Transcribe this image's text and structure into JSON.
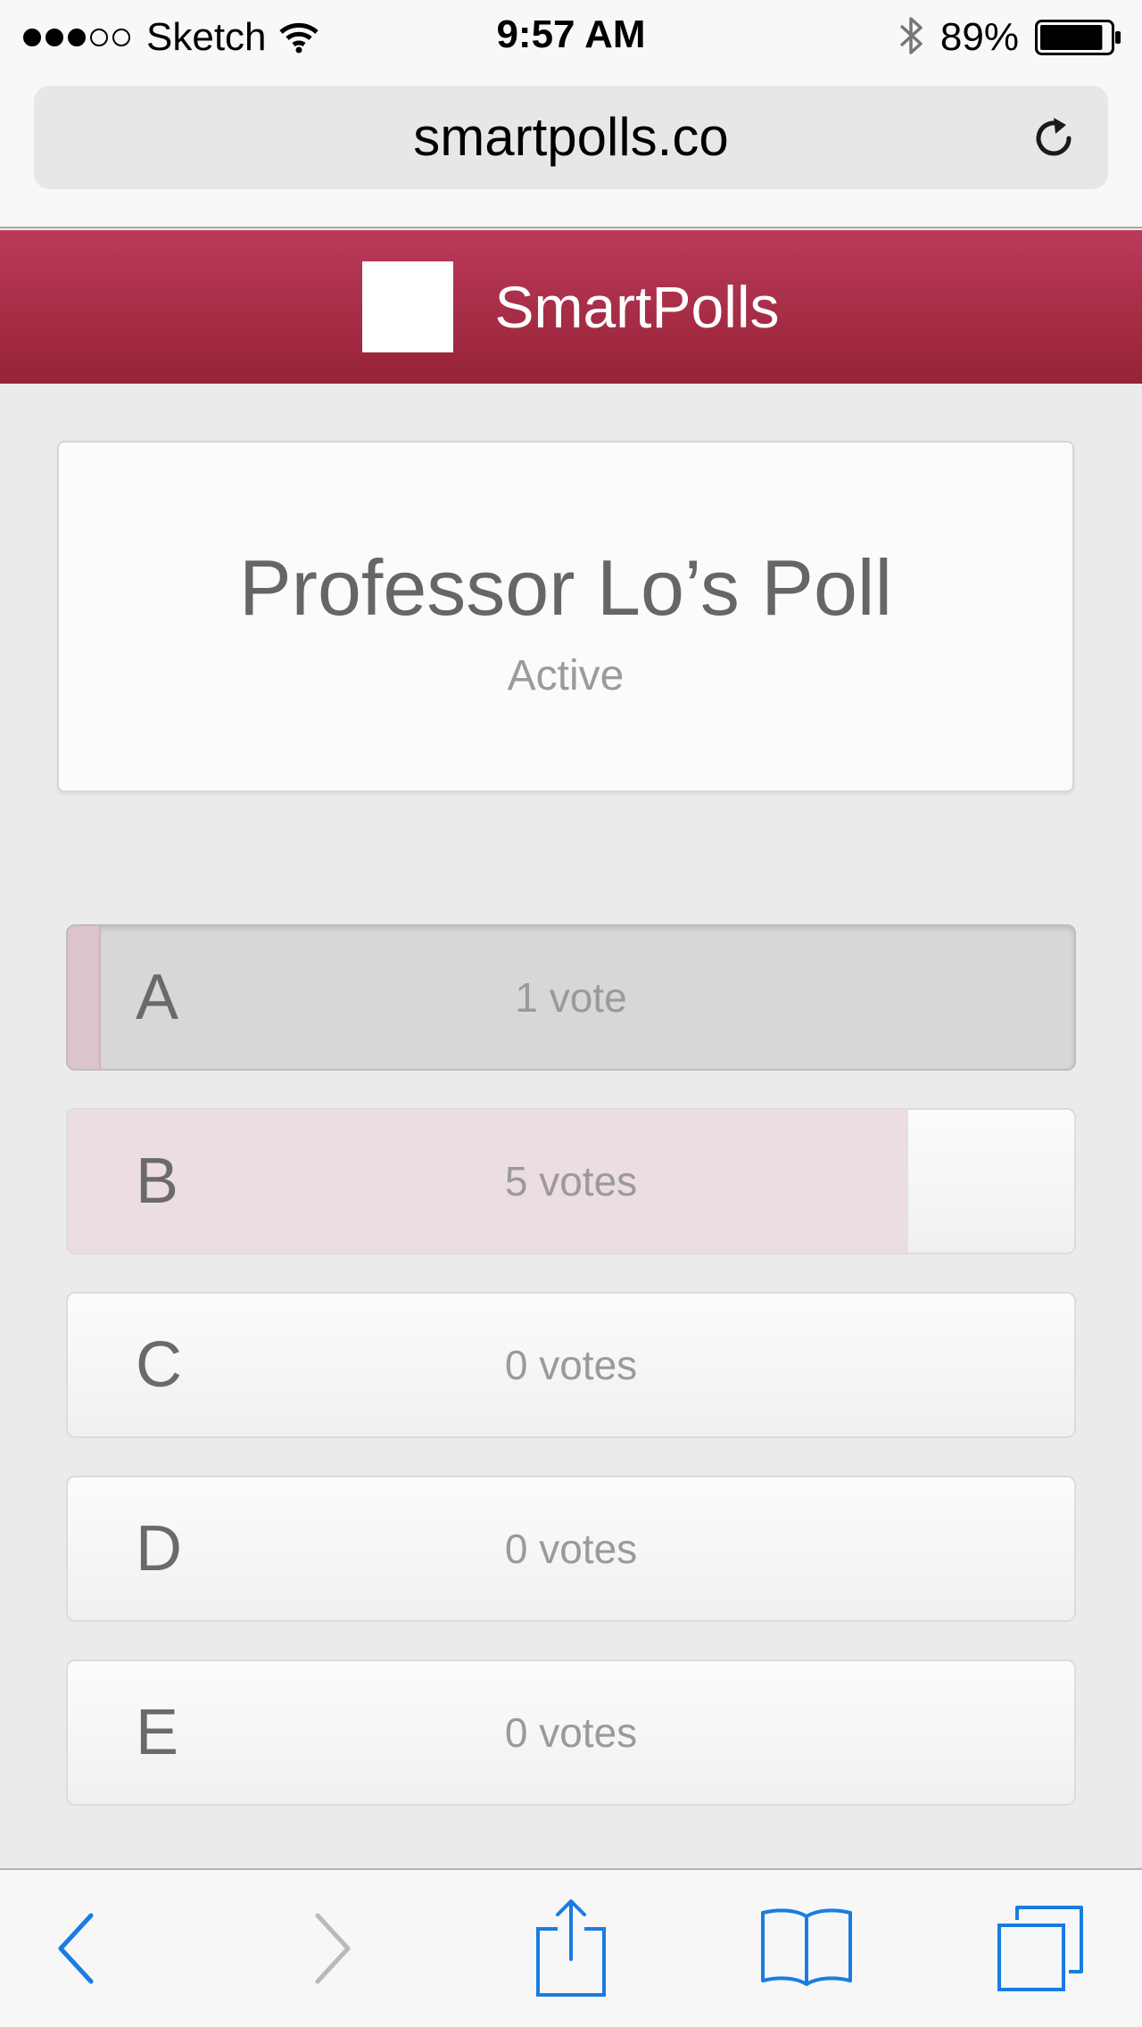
{
  "status_bar": {
    "carrier": "Sketch",
    "time": "9:57 AM",
    "battery_percent": "89%",
    "signal_bars_filled": 3,
    "signal_bars_total": 5,
    "battery_level": 0.89
  },
  "browser": {
    "url": "smartpolls.co",
    "reload_icon": "reload-icon"
  },
  "header": {
    "brand_name": "SmartPolls",
    "logo_icon": "logo-square"
  },
  "poll": {
    "title": "Professor Lo’s Poll",
    "status": "Active"
  },
  "options": [
    {
      "letter": "A",
      "votes_label": "1 vote",
      "votes": 1,
      "selected": true
    },
    {
      "letter": "B",
      "votes_label": "5 votes",
      "votes": 5,
      "selected": false
    },
    {
      "letter": "C",
      "votes_label": "0 votes",
      "votes": 0,
      "selected": false
    },
    {
      "letter": "D",
      "votes_label": "0 votes",
      "votes": 0,
      "selected": false
    },
    {
      "letter": "E",
      "votes_label": "0 votes",
      "votes": 0,
      "selected": false
    }
  ],
  "toolbar": {
    "back_icon": "chevron-left-icon",
    "forward_icon": "chevron-right-icon",
    "share_icon": "share-icon",
    "bookmarks_icon": "book-icon",
    "tabs_icon": "tabs-icon"
  },
  "colors": {
    "brand_top": "#bb3a5a",
    "brand_bottom": "#962337",
    "vote_fill": "#ecdde1",
    "ios_blue": "#1a7ce0"
  }
}
